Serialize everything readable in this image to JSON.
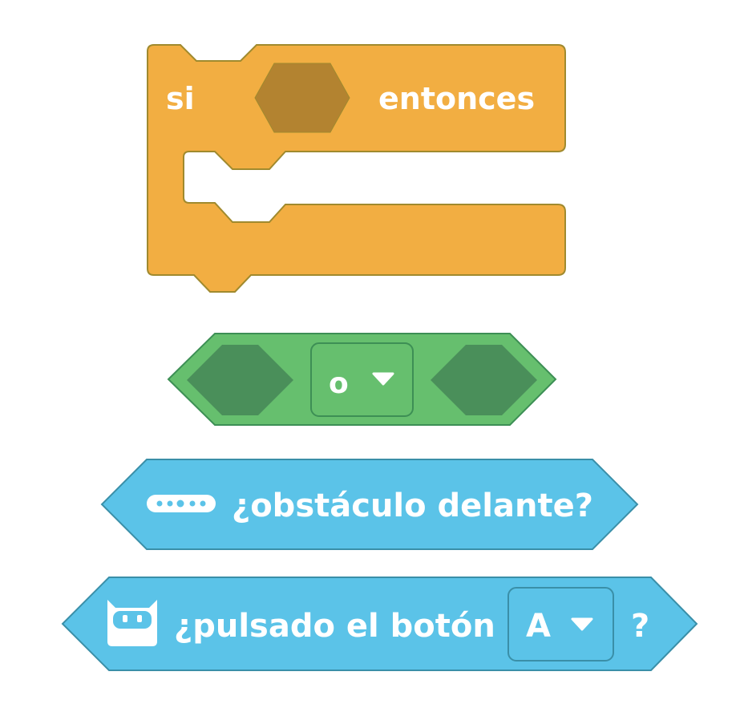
{
  "if_block": {
    "label_if": "si",
    "label_then": "entonces",
    "color": "#f2ae42",
    "outline": "#a08a2e",
    "slot_color": "#b38330"
  },
  "or_block": {
    "operator": "o",
    "color": "#66bf6e",
    "outline": "#3d8f55",
    "slot_color": "#4a8f5a"
  },
  "obstacle_block": {
    "label": "¿obstáculo delante?",
    "icon": "sensor-bar-icon",
    "color": "#5bc3e8",
    "outline": "#3a8fa8"
  },
  "button_block": {
    "label": "¿pulsado el botón",
    "button_value": "A",
    "suffix": "?",
    "icon": "robot-face-icon",
    "color": "#5bc3e8",
    "outline": "#3a8fa8"
  }
}
